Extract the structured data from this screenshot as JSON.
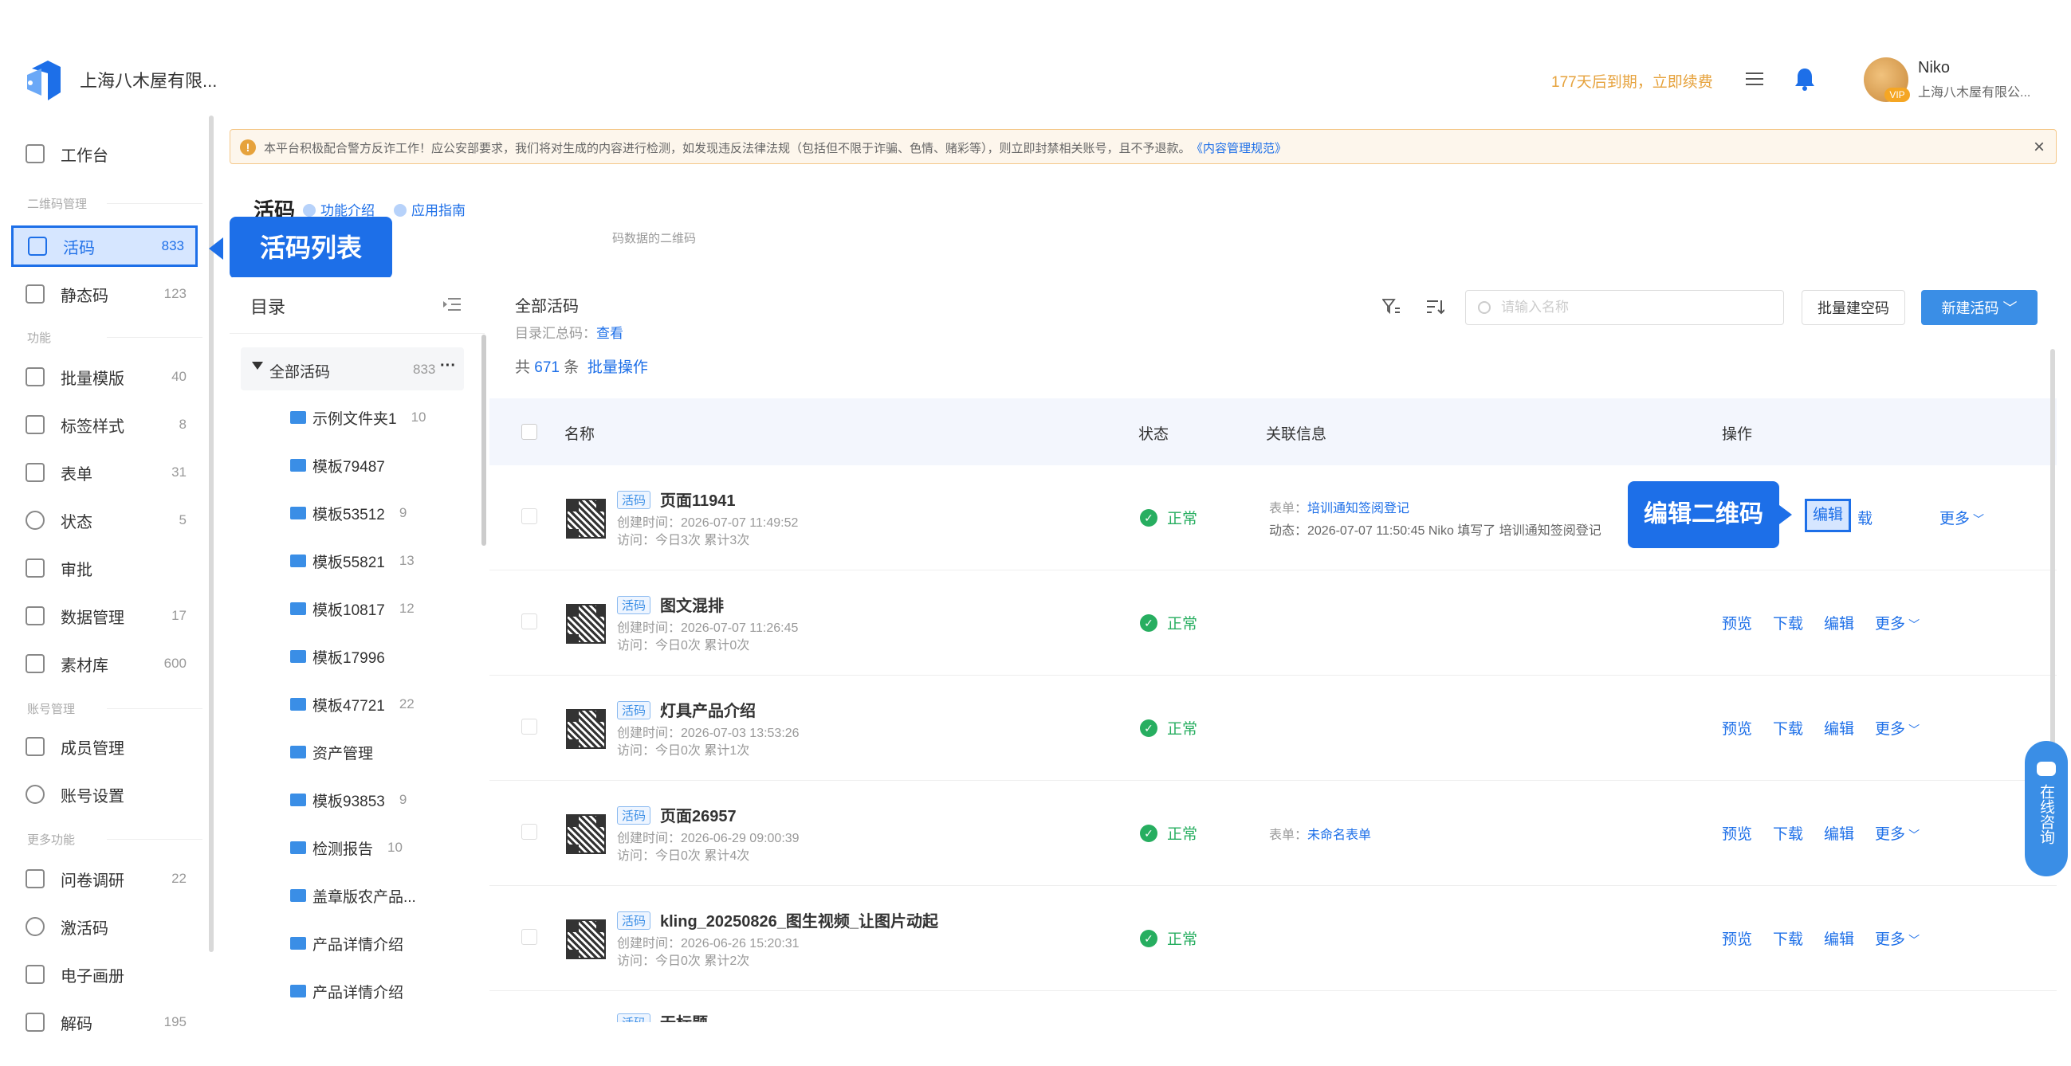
{
  "header": {
    "company": "上海八木屋有限...",
    "renew_notice": "177天后到期，立即续费",
    "user_name": "Niko",
    "user_org": "上海八木屋有限公...",
    "vip_label": "VIP"
  },
  "sidebar": {
    "items": [
      {
        "label": "工作台",
        "count": ""
      },
      {
        "label": "活码",
        "count": "833"
      },
      {
        "label": "静态码",
        "count": "123"
      },
      {
        "label": "批量模版",
        "count": "40"
      },
      {
        "label": "标签样式",
        "count": "8"
      },
      {
        "label": "表单",
        "count": "31"
      },
      {
        "label": "状态",
        "count": "5"
      },
      {
        "label": "审批",
        "count": ""
      },
      {
        "label": "数据管理",
        "count": "17"
      },
      {
        "label": "素材库",
        "count": "600"
      },
      {
        "label": "成员管理",
        "count": ""
      },
      {
        "label": "账号设置",
        "count": ""
      },
      {
        "label": "问卷调研",
        "count": "22"
      },
      {
        "label": "激活码",
        "count": ""
      },
      {
        "label": "电子画册",
        "count": ""
      },
      {
        "label": "解码",
        "count": "195"
      }
    ],
    "groups": [
      "二维码管理",
      "功能",
      "账号管理",
      "更多功能"
    ]
  },
  "notice": {
    "text": "本平台积极配合警方反诈工作！应公安部要求，我们将对生成的内容进行检测，如发现违反法律法规（包括但不限于诈骗、色情、赌彩等），则立即封禁相关账号，且不予退款。",
    "link": "《内容管理规范》",
    "close": "×"
  },
  "page": {
    "title": "活码",
    "link_intro": "功能介绍",
    "link_guide": "应用指南",
    "subtitle": "码数据的二维码"
  },
  "callouts": {
    "list": "活码列表",
    "edit": "编辑二维码"
  },
  "directory": {
    "title": "目录",
    "root_label": "全部活码",
    "root_count": "833",
    "root_more": "···",
    "folders": [
      {
        "name": "示例文件夹1",
        "count": "10"
      },
      {
        "name": "模板79487",
        "count": ""
      },
      {
        "name": "模板53512",
        "count": "9"
      },
      {
        "name": "模板55821",
        "count": "13"
      },
      {
        "name": "模板10817",
        "count": "12"
      },
      {
        "name": "模板17996",
        "count": ""
      },
      {
        "name": "模板47721",
        "count": "22"
      },
      {
        "name": "资产管理",
        "count": ""
      },
      {
        "name": "模板93853",
        "count": "9"
      },
      {
        "name": "检测报告",
        "count": "10"
      },
      {
        "name": "盖章版农产品...",
        "count": ""
      },
      {
        "name": "产品详情介绍",
        "count": ""
      },
      {
        "name": "产品详情介绍",
        "count": ""
      }
    ]
  },
  "list": {
    "title": "全部活码",
    "summary_label": "目录汇总码：",
    "summary_link": "查看",
    "total_prefix": "共",
    "total_num": "671",
    "total_suffix": "条",
    "batch_ops": "批量操作",
    "search_placeholder": "请输入名称",
    "btn_batch_empty": "批量建空码",
    "btn_new": "新建活码",
    "columns": {
      "name": "名称",
      "status": "状态",
      "relation": "关联信息",
      "ops": "操作"
    },
    "rows": [
      {
        "tag": "活码",
        "name": "页面11941",
        "created": "创建时间：2026-07-07 11:49:52",
        "visit": "访问：今日3次 累计3次",
        "status": "正常",
        "rel_label": "表单：",
        "rel_link": "培训通知签阅登记",
        "rel_dyn": "动态：2026-07-07 11:50:45  Niko  填写了 培训通知签阅登记"
      },
      {
        "tag": "活码",
        "name": "图文混排",
        "created": "创建时间：2026-07-07 11:26:45",
        "visit": "访问：今日0次 累计0次",
        "status": "正常",
        "rel_label": "",
        "rel_link": "",
        "rel_dyn": ""
      },
      {
        "tag": "活码",
        "name": "灯具产品介绍",
        "created": "创建时间：2026-07-03 13:53:26",
        "visit": "访问：今日0次 累计1次",
        "status": "正常",
        "rel_label": "",
        "rel_link": "",
        "rel_dyn": ""
      },
      {
        "tag": "活码",
        "name": "页面26957",
        "created": "创建时间：2026-06-29 09:00:39",
        "visit": "访问：今日0次 累计4次",
        "status": "正常",
        "rel_label": "表单：",
        "rel_link": "未命名表单",
        "rel_dyn": ""
      },
      {
        "tag": "活码",
        "name": "kling_20250826_图生视频_让图片动起",
        "created": "创建时间：2026-06-26 15:20:31",
        "visit": "访问：今日0次 累计2次",
        "status": "正常",
        "rel_label": "",
        "rel_link": "",
        "rel_dyn": ""
      },
      {
        "tag": "活码",
        "name": "无标题",
        "created": "",
        "visit": "",
        "status": "",
        "rel_label": "",
        "rel_link": "",
        "rel_dyn": ""
      }
    ],
    "ops": {
      "preview": "预览",
      "download": "下载",
      "edit": "编辑",
      "more": "更多",
      "partial_download": "载"
    }
  },
  "consult": {
    "text": "在线咨询"
  }
}
